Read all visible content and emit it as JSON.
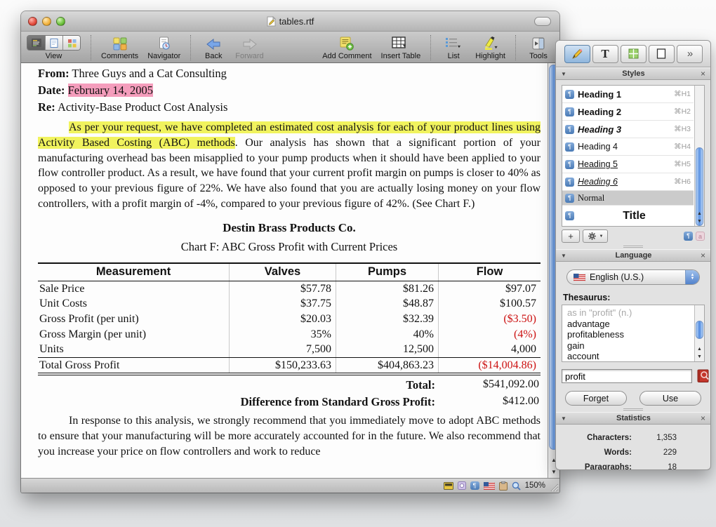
{
  "window": {
    "title": "tables.rtf",
    "toolbar": {
      "view": "View",
      "comments": "Comments",
      "navigator": "Navigator",
      "back": "Back",
      "forward": "Forward",
      "add_comment": "Add Comment",
      "insert_table": "Insert Table",
      "list": "List",
      "highlight": "Highlight",
      "tools": "Tools"
    },
    "statusbar": {
      "zoom_level": "150%"
    }
  },
  "document": {
    "from_label": "From:",
    "from_value": "Three Guys and a Cat Consulting",
    "date_label": "Date:",
    "date_value": "February 14, 2005",
    "re_label": "Re:",
    "re_value": "Activity-Base Product Cost Analysis",
    "para1_highlighted": "As per your request, we have completed an estimated cost analysis for each of your product lines using Activity Based Costing (ABC) methods",
    "para1_rest": ". Our analysis has shown that a significant portion of your manufacturing overhead bas been misapplied to your pump products when it should have been applied to your flow controller product. As a result, we have found that your current profit margin on pumps is closer to 40% as opposed to your previous figure of 22%. We have also found that you are actually losing money on your flow controllers, with a profit margin of -4%, compared to your previous figure of 42%. (See Chart F.)",
    "company": "Destin Brass Products Co.",
    "chart_title": "Chart F: ABC Gross Profit with Current Prices",
    "table": {
      "headers": [
        "Measurement",
        "Valves",
        "Pumps",
        "Flow"
      ],
      "rows": [
        {
          "label": "Sale Price",
          "valves": "$57.78",
          "pumps": "$81.26",
          "flow": "$97.07"
        },
        {
          "label": "Unit Costs",
          "valves": "$37.75",
          "pumps": "$48.87",
          "flow": "$100.57"
        },
        {
          "label": "Gross Profit (per unit)",
          "valves": "$20.03",
          "pumps": "$32.39",
          "flow": "($3.50)"
        },
        {
          "label": "Gross Margin (per unit)",
          "valves": "35%",
          "pumps": "40%",
          "flow": "(4%)"
        },
        {
          "label": "Units",
          "valves": "7,500",
          "pumps": "12,500",
          "flow": "4,000"
        },
        {
          "label": "Total Gross Profit",
          "valves": "$150,233.63",
          "pumps": "$404,863.23",
          "flow": "($14,004.86)"
        }
      ],
      "total_label": "Total:",
      "total_value": "$541,092.00",
      "difference_label": "Difference from Standard Gross Profit:",
      "difference_value": "$412.00"
    },
    "para2": "In response to this analysis, we strongly recommend that you immediately move to adopt ABC methods to ensure that your manufacturing will be more accurately accounted for in the future. We also recommend that you increase your price on flow controllers and work to reduce"
  },
  "palette": {
    "styles": {
      "title": "Styles",
      "items": [
        {
          "label": "Heading 1",
          "shortcut": "⌘H1"
        },
        {
          "label": "Heading 2",
          "shortcut": "⌘H2"
        },
        {
          "label": "Heading 3",
          "shortcut": "⌘H3"
        },
        {
          "label": "Heading 4",
          "shortcut": "⌘H4"
        },
        {
          "label": "Heading 5",
          "shortcut": "⌘H5"
        },
        {
          "label": "Heading 6",
          "shortcut": "⌘H6"
        },
        {
          "label": "Normal",
          "shortcut": ""
        },
        {
          "label": "Title",
          "shortcut": ""
        }
      ]
    },
    "language": {
      "title": "Language",
      "selected_language": "English (U.S.)",
      "thesaurus_label": "Thesaurus:",
      "entries": [
        "as in \"profit\" (n.)",
        "advantage",
        "profitableness",
        "gain",
        "account"
      ],
      "search_value": "profit",
      "forget_button": "Forget",
      "use_button": "Use"
    },
    "statistics": {
      "title": "Statistics",
      "rows": [
        {
          "label": "Characters:",
          "value": "1,353"
        },
        {
          "label": "Words:",
          "value": "229"
        },
        {
          "label": "Paragraphs:",
          "value": "18"
        }
      ]
    }
  },
  "icons": {
    "paragraph_glyph": "¶",
    "char_style_glyph": "a",
    "close_glyph": "×",
    "disclosure_glyph": "▼",
    "up_glyph": "▲",
    "down_glyph": "▼",
    "plus_glyph": "+",
    "text_tool_glyph": "T",
    "chevron_double_glyph": "»",
    "dropdown_tri_glyph": "▼"
  },
  "colors": {
    "highlight_pink": "#f49dbc",
    "highlight_yellow": "#f1f35e",
    "negative_red": "#cc1111",
    "aqua_blue": "#6aa0ee"
  }
}
